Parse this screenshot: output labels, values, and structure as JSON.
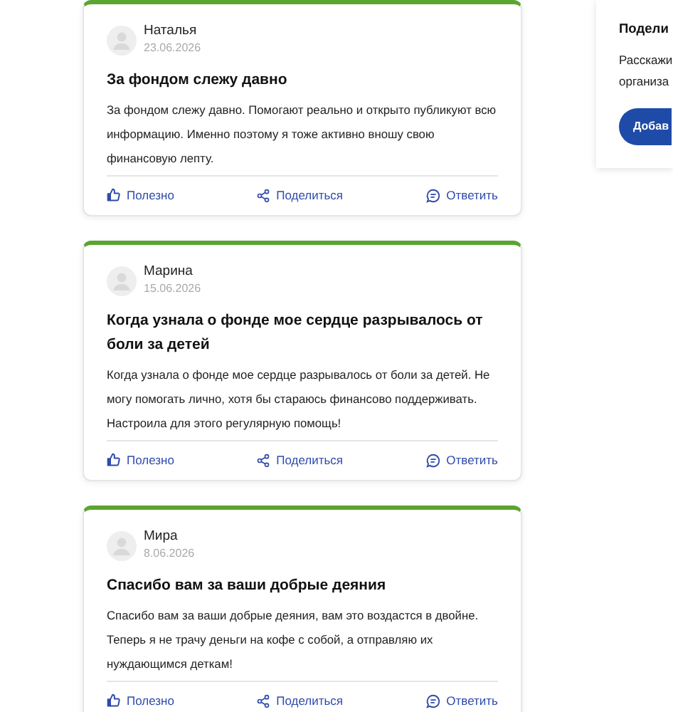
{
  "reviews": [
    {
      "author": "Наталья",
      "date": "23.06.2026",
      "title": "За фондом слежу давно",
      "text": "За фондом слежу давно. Помогают реально и открыто публикуют всю информацию. Именно поэтому я тоже активно вношу свою финансовую лепту.",
      "actions": [
        "Полезно",
        "Поделиться",
        "Ответить"
      ]
    },
    {
      "author": "Марина",
      "date": "15.06.2026",
      "title": "Когда узнала о фонде мое сердце разрывалось от боли за детей",
      "text": "Когда узнала о фонде мое сердце разрывалось от боли за детей. Не могу помогать лично, хотя бы стараюсь финансово поддерживать. Настроила для этого регулярную помощь!",
      "actions": [
        "Полезно",
        "Поделиться",
        "Ответить"
      ]
    },
    {
      "author": "Мира",
      "date": "8.06.2026",
      "title": "Спасибо вам за ваши добрые деяния",
      "text": "Спасибо вам за ваши добрые деяния, вам это воздастся в двойне. Теперь я не трачу деньги на кофе с собой, а отправляю их нуждающимся деткам!",
      "actions": [
        "Полезно",
        "Поделиться",
        "Ответить"
      ]
    }
  ],
  "side_panel": {
    "title": "Подели",
    "text_lines": [
      "Расскажи",
      "организа"
    ],
    "button": "Добав"
  }
}
